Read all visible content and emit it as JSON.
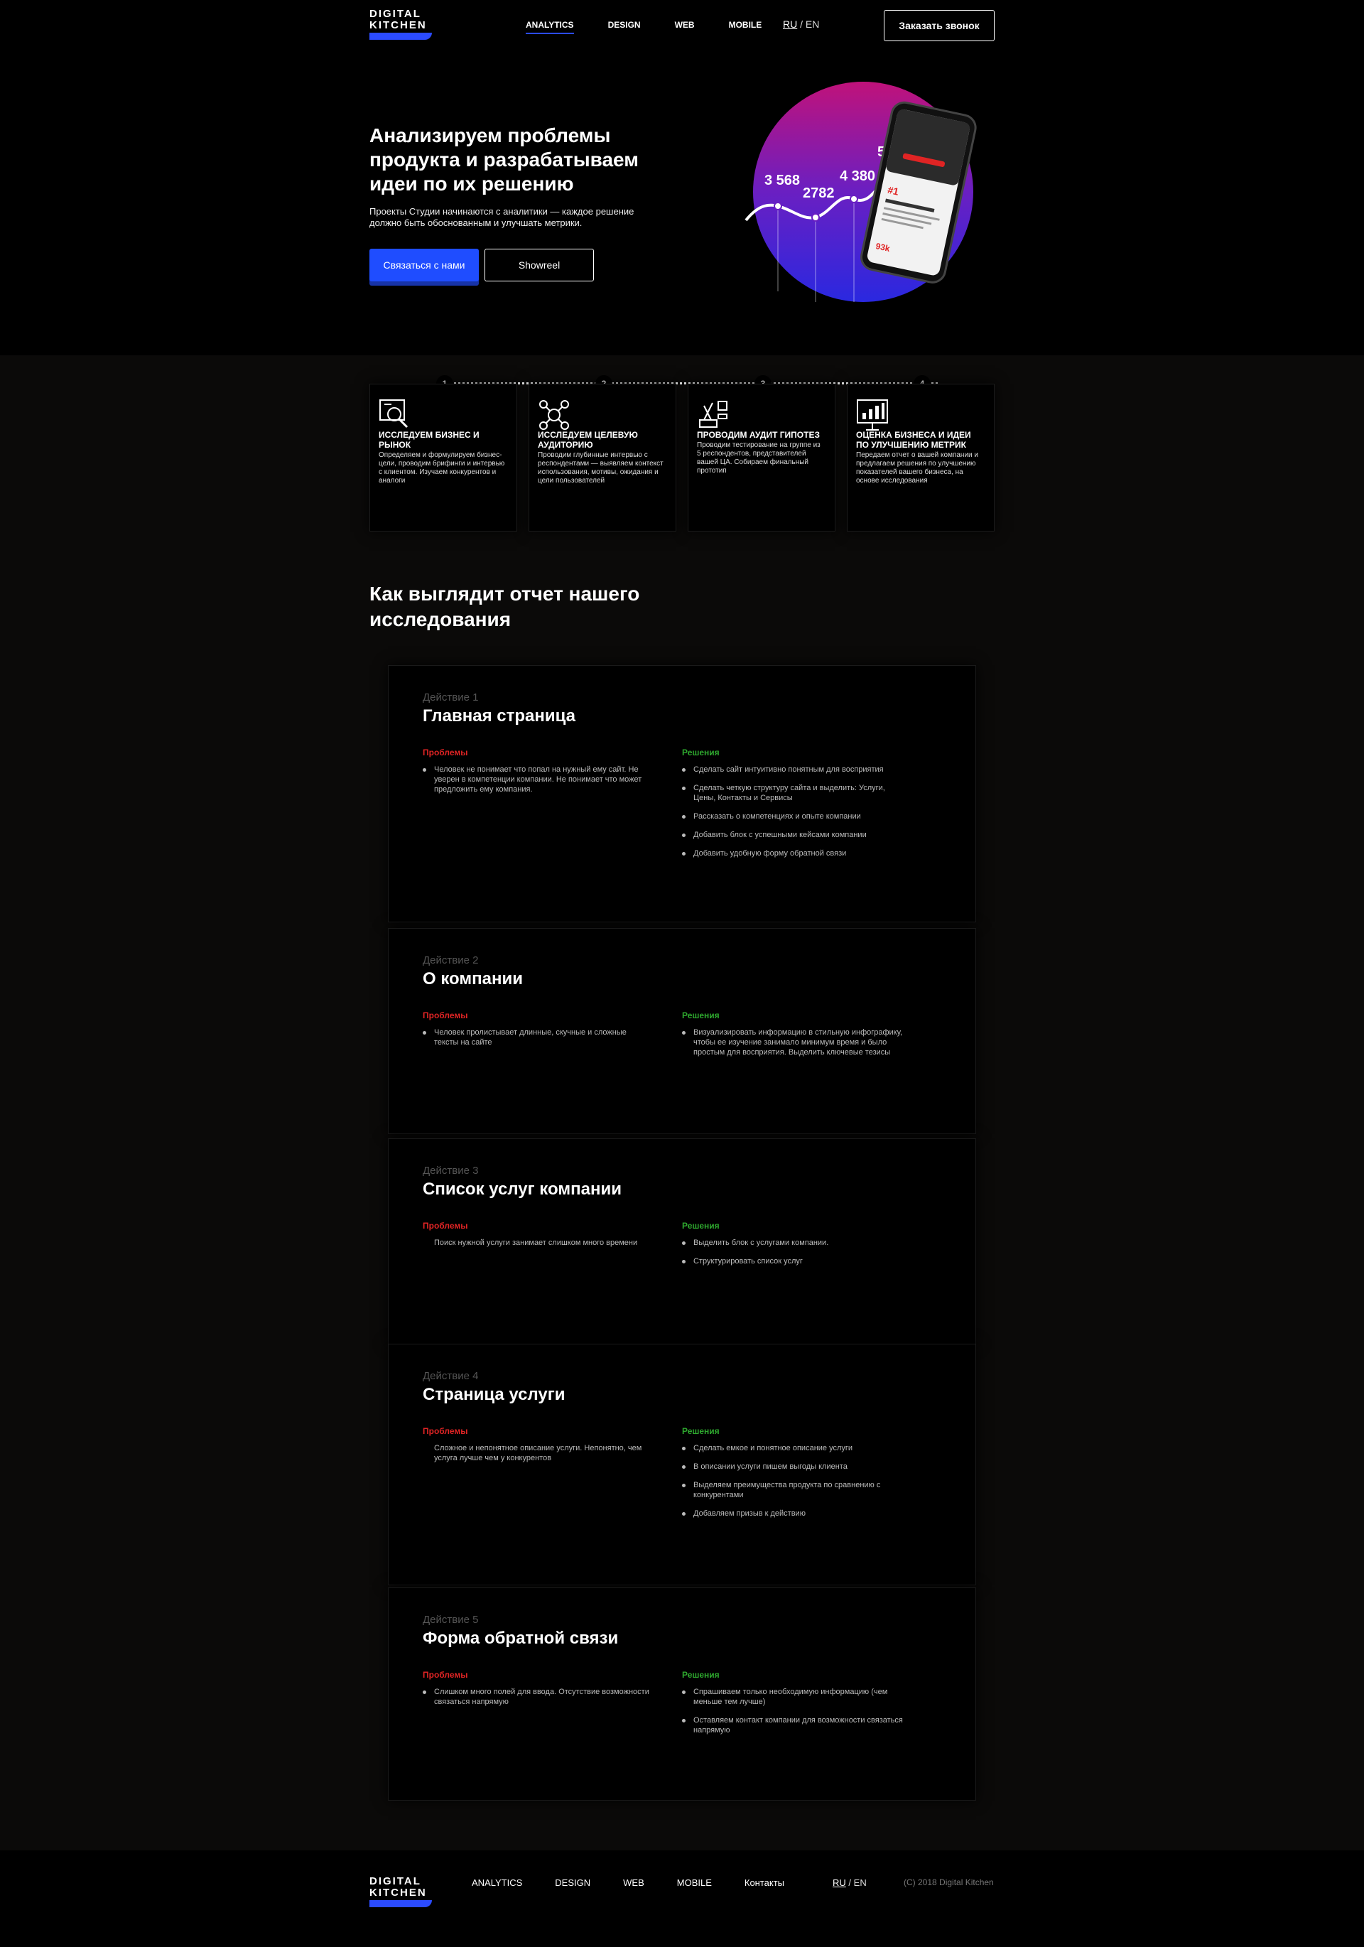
{
  "header": {
    "logo_line1": "DIGITAL",
    "logo_line2": "KITCHEN",
    "nav": [
      "ANALYTICS",
      "DESIGN",
      "WEB",
      "MOBILE"
    ],
    "lang_ru": "RU",
    "lang_sep": "/",
    "lang_en": "EN",
    "call_button": "Заказать звонок"
  },
  "hero": {
    "title": "Анализируем проблемы продукта и разрабатываем идеи по их решению",
    "subtitle": "Проекты Студии начинаются с аналитики — каждое решение должно быть обоснованным и улучшать метрики.",
    "primary_button": "Связаться с нами",
    "secondary_button": "Showreel",
    "stats": [
      "3 568",
      "2782",
      "4 380",
      "5"
    ],
    "phone_rank": "#1",
    "phone_value": "93k"
  },
  "steps": [
    {
      "num": "1",
      "title": "ИССЛЕДУЕМ БИЗНЕС И РЫНОК",
      "text": "Определяем и формулируем бизнес-цели, проводим брифинги и интервью с клиентом. Изучаем конкурентов и аналоги",
      "icon": "research-icon"
    },
    {
      "num": "2",
      "title": "ИССЛЕДУЕМ ЦЕЛЕВУЮ АУДИТОРИЮ",
      "text": "Проводим глубинные интервью с респондентами — выявляем контекст использования, мотивы, ожидания и цели пользователей",
      "icon": "audience-icon"
    },
    {
      "num": "3",
      "title": "ПРОВОДИМ АУДИТ ГИПОТЕЗ",
      "text": "Проводим тестирование на группе из 5 респондентов, представителей вашей ЦА. Собираем финальный прототип",
      "icon": "test-icon"
    },
    {
      "num": "4",
      "title": "ОЦЕНКА БИЗНЕСА И ИДЕИ ПО УЛУЧШЕНИЮ МЕТРИК",
      "text": "Передаем отчет о вашей компании и предлагаем решения по улучшению показателей вашего бизнеса, на основе исследования",
      "icon": "report-icon"
    }
  ],
  "report": {
    "title": "Как выглядит отчет нашего исследования",
    "problems_label": "Проблемы",
    "solutions_label": "Решения",
    "blocks": [
      {
        "step": "Действие 1",
        "title": "Главная страница",
        "problems": [
          "Человек не понимает что попал на нужный ему сайт. Не уверен в компетенции компании. Не понимает что может предложить ему компания."
        ],
        "solutions": [
          "Сделать сайт интуитивно понятным для восприятия",
          "Сделать четкую структуру сайта и выделить: Услуги, Цены, Контакты и Сервисы",
          "Рассказать о компетенциях и опыте компании",
          "Добавить блок с успешными кейсами компании",
          "Добавить удобную форму обратной связи"
        ]
      },
      {
        "step": "Действие 2",
        "title": "О компании",
        "problems": [
          "Человек пролистывает длинные, скучные и сложные тексты на сайте"
        ],
        "solutions": [
          "Визуализировать информацию в стильную инфографику, чтобы ее изучение занимало минимум время и было простым для восприятия. Выделить ключевые тезисы"
        ]
      },
      {
        "step": "Действие 3",
        "title": "Список услуг компании",
        "problems": [
          "Поиск нужной услуги занимает слишком много времени"
        ],
        "solutions": [
          "Выделить блок с услугами компании.",
          "Структурировать список услуг"
        ]
      },
      {
        "step": "Действие 4",
        "title": "Страница услуги",
        "problems": [
          "Сложное и непонятное описание услуги. Непонятно, чем услуга лучше чем у конкурентов"
        ],
        "solutions": [
          "Сделать емкое и понятное описание услуги",
          "В описании услуги пишем выгоды клиента",
          "Выделяем преимущества продукта по сравнению с конкурентами",
          "Добавляем призыв к действию"
        ]
      },
      {
        "step": "Действие 5",
        "title": "Форма обратной связи",
        "problems": [
          "Слишком много полей для ввода. Отсутствие возможности связаться напрямую"
        ],
        "solutions": [
          "Спрашиваем только необходимую информацию (чем меньше тем лучше)",
          "Оставляем контакт компании для возможности связаться напрямую"
        ]
      }
    ]
  },
  "footer": {
    "nav": [
      "ANALYTICS",
      "DESIGN",
      "WEB",
      "MOBILE",
      "Контакты"
    ],
    "lang_ru": "RU",
    "lang_sep": "/",
    "lang_en": "EN",
    "copyright": "(C) 2018 Digital Kitchen"
  },
  "colors": {
    "accent": "#1f4dff",
    "problem": "#e02424",
    "solution": "#2ea82e"
  }
}
